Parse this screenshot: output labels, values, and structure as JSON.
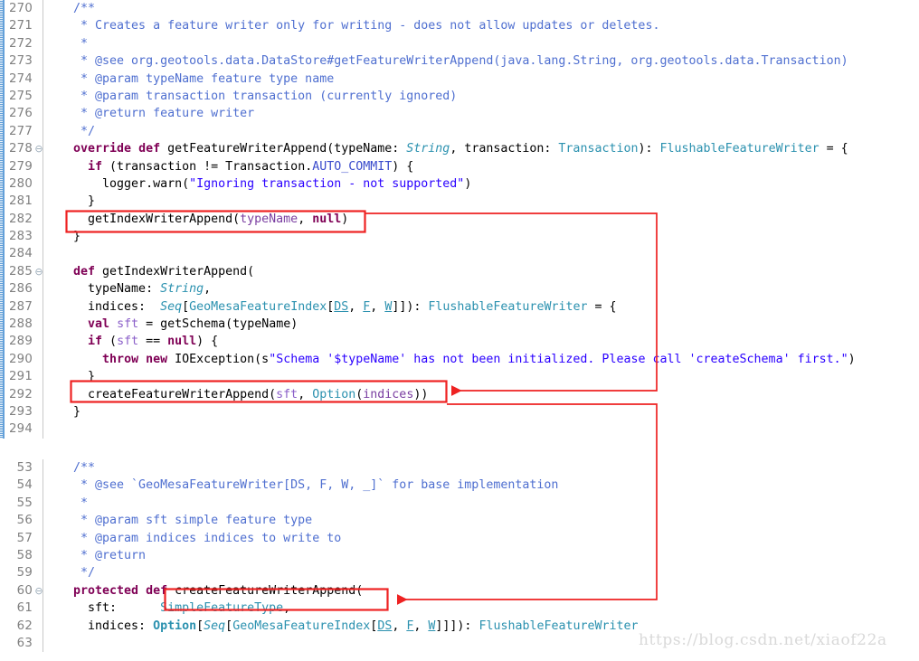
{
  "editor": {
    "font_size_px": 13.3,
    "line_height_px": 19.4,
    "gutter_strip_color": "#64a0d8",
    "line_number_color": "#808080",
    "fold_marker_glyph": "⊖",
    "background": "#ffffff"
  },
  "annotation": {
    "color": "#ee2222",
    "boxes": [
      {
        "id": "box-282",
        "label": "getIndexWriterAppend(typeName, null)"
      },
      {
        "id": "box-292",
        "label": "createFeatureWriterAppend(sft, Option(indices))"
      },
      {
        "id": "box-60",
        "label": "createFeatureWriterAppend("
      }
    ],
    "connectors": [
      {
        "id": "connector-282-to-292",
        "from": "box-282",
        "to": "box-292"
      },
      {
        "id": "connector-292-to-60",
        "from": "box-292",
        "to": "box-60"
      }
    ]
  },
  "watermark": {
    "text": "https://blog.csdn.net/xiaof22a"
  },
  "blocks": [
    {
      "id": "block-top",
      "has_change_strip": true,
      "lines": [
        {
          "no": "270",
          "fold": "",
          "segments": [
            {
              "t": "  /**",
              "c": "c-cmt"
            }
          ]
        },
        {
          "no": "271",
          "fold": "",
          "segments": [
            {
              "t": "   * Creates a feature writer only for writing - does not allow updates or deletes.",
              "c": "c-cmt"
            }
          ]
        },
        {
          "no": "272",
          "fold": "",
          "segments": [
            {
              "t": "   *",
              "c": "c-cmt"
            }
          ]
        },
        {
          "no": "273",
          "fold": "",
          "segments": [
            {
              "t": "   * @see org.geotools.data.DataStore#getFeatureWriterAppend(java.lang.String, org.geotools.data.Transaction)",
              "c": "c-cmt"
            }
          ]
        },
        {
          "no": "274",
          "fold": "",
          "segments": [
            {
              "t": "   * @param typeName feature type name",
              "c": "c-cmt"
            }
          ]
        },
        {
          "no": "275",
          "fold": "",
          "segments": [
            {
              "t": "   * @param transaction transaction (currently ignored)",
              "c": "c-cmt"
            }
          ]
        },
        {
          "no": "276",
          "fold": "",
          "segments": [
            {
              "t": "   * @return feature writer",
              "c": "c-cmt"
            }
          ]
        },
        {
          "no": "277",
          "fold": "",
          "segments": [
            {
              "t": "   */",
              "c": "c-cmt"
            }
          ]
        },
        {
          "no": "278",
          "fold": "⊖",
          "segments": [
            {
              "t": "  ",
              "c": "c-pln"
            },
            {
              "t": "override def",
              "c": "c-kw"
            },
            {
              "t": " getFeatureWriterAppend(typeName: ",
              "c": "c-pln"
            },
            {
              "t": "String",
              "c": "c-typi"
            },
            {
              "t": ", transaction: ",
              "c": "c-pln"
            },
            {
              "t": "Transaction",
              "c": "c-typ"
            },
            {
              "t": "): ",
              "c": "c-pln"
            },
            {
              "t": "FlushableFeatureWriter",
              "c": "c-typ"
            },
            {
              "t": " = {",
              "c": "c-pln"
            }
          ]
        },
        {
          "no": "279",
          "fold": "",
          "segments": [
            {
              "t": "    ",
              "c": "c-pln"
            },
            {
              "t": "if",
              "c": "c-kw"
            },
            {
              "t": " (transaction != Transaction.",
              "c": "c-pln"
            },
            {
              "t": "AUTO_COMMIT",
              "c": "c-stc"
            },
            {
              "t": ") {",
              "c": "c-pln"
            }
          ]
        },
        {
          "no": "280",
          "fold": "",
          "segments": [
            {
              "t": "      logger.warn(",
              "c": "c-pln"
            },
            {
              "t": "\"Ignoring transaction - not supported\"",
              "c": "c-str"
            },
            {
              "t": ")",
              "c": "c-pln"
            }
          ]
        },
        {
          "no": "281",
          "fold": "",
          "segments": [
            {
              "t": "    }",
              "c": "c-pln"
            }
          ]
        },
        {
          "no": "282",
          "fold": "",
          "segments": [
            {
              "t": "    getIndexWriterAppend(",
              "c": "c-pln"
            },
            {
              "t": "typeName",
              "c": "c-fld"
            },
            {
              "t": ", ",
              "c": "c-pln"
            },
            {
              "t": "null",
              "c": "c-kw"
            },
            {
              "t": ")",
              "c": "c-pln"
            }
          ]
        },
        {
          "no": "283",
          "fold": "",
          "segments": [
            {
              "t": "  }",
              "c": "c-pln"
            }
          ]
        },
        {
          "no": "284",
          "fold": "",
          "segments": [
            {
              "t": "",
              "c": "c-pln"
            }
          ]
        },
        {
          "no": "285",
          "fold": "⊖",
          "segments": [
            {
              "t": "  ",
              "c": "c-pln"
            },
            {
              "t": "def",
              "c": "c-kw"
            },
            {
              "t": " getIndexWriterAppend(",
              "c": "c-pln"
            }
          ]
        },
        {
          "no": "286",
          "fold": "",
          "segments": [
            {
              "t": "    typeName: ",
              "c": "c-pln"
            },
            {
              "t": "String",
              "c": "c-typi"
            },
            {
              "t": ",",
              "c": "c-pln"
            }
          ]
        },
        {
          "no": "287",
          "fold": "",
          "segments": [
            {
              "t": "    indices:  ",
              "c": "c-pln"
            },
            {
              "t": "Seq",
              "c": "c-typi"
            },
            {
              "t": "[",
              "c": "c-pln"
            },
            {
              "t": "GeoMesaFeatureIndex",
              "c": "c-typ"
            },
            {
              "t": "[",
              "c": "c-pln"
            },
            {
              "t": "DS",
              "c": "c-typu"
            },
            {
              "t": ", ",
              "c": "c-pln"
            },
            {
              "t": "F",
              "c": "c-typu"
            },
            {
              "t": ", ",
              "c": "c-pln"
            },
            {
              "t": "W",
              "c": "c-typu"
            },
            {
              "t": "]]): ",
              "c": "c-pln"
            },
            {
              "t": "FlushableFeatureWriter",
              "c": "c-typ"
            },
            {
              "t": " = {",
              "c": "c-pln"
            }
          ]
        },
        {
          "no": "288",
          "fold": "",
          "segments": [
            {
              "t": "    ",
              "c": "c-pln"
            },
            {
              "t": "val",
              "c": "c-kw"
            },
            {
              "t": " ",
              "c": "c-pln"
            },
            {
              "t": "sft",
              "c": "c-var"
            },
            {
              "t": " = getSchema(typeName)",
              "c": "c-pln"
            }
          ]
        },
        {
          "no": "289",
          "fold": "",
          "segments": [
            {
              "t": "    ",
              "c": "c-pln"
            },
            {
              "t": "if",
              "c": "c-kw"
            },
            {
              "t": " (",
              "c": "c-pln"
            },
            {
              "t": "sft",
              "c": "c-var"
            },
            {
              "t": " == ",
              "c": "c-pln"
            },
            {
              "t": "null",
              "c": "c-kw"
            },
            {
              "t": ") {",
              "c": "c-pln"
            }
          ]
        },
        {
          "no": "290",
          "fold": "",
          "segments": [
            {
              "t": "      ",
              "c": "c-pln"
            },
            {
              "t": "throw new",
              "c": "c-kw"
            },
            {
              "t": " IOException(s",
              "c": "c-pln"
            },
            {
              "t": "\"Schema '$typeName' has not been initialized. Please call 'createSchema' first.\"",
              "c": "c-str"
            },
            {
              "t": ")",
              "c": "c-pln"
            }
          ]
        },
        {
          "no": "291",
          "fold": "",
          "segments": [
            {
              "t": "    }",
              "c": "c-pln"
            }
          ]
        },
        {
          "no": "292",
          "fold": "",
          "segments": [
            {
              "t": "    createFeatureWriterAppend(",
              "c": "c-pln"
            },
            {
              "t": "sft",
              "c": "c-var"
            },
            {
              "t": ", ",
              "c": "c-pln"
            },
            {
              "t": "Option",
              "c": "c-typ"
            },
            {
              "t": "(",
              "c": "c-pln"
            },
            {
              "t": "indices",
              "c": "c-fld"
            },
            {
              "t": "))",
              "c": "c-pln"
            }
          ]
        },
        {
          "no": "293",
          "fold": "",
          "segments": [
            {
              "t": "  }",
              "c": "c-pln"
            }
          ]
        },
        {
          "no": "294",
          "fold": "",
          "segments": [
            {
              "t": "",
              "c": "c-pln"
            }
          ]
        }
      ]
    },
    {
      "id": "block-bottom",
      "has_change_strip": false,
      "lines": [
        {
          "no": "53",
          "fold": "",
          "segments": [
            {
              "t": "  /**",
              "c": "c-cmt"
            }
          ]
        },
        {
          "no": "54",
          "fold": "",
          "segments": [
            {
              "t": "   * @see `GeoMesaFeatureWriter[DS, F, W, _]` for base implementation",
              "c": "c-cmt"
            }
          ]
        },
        {
          "no": "55",
          "fold": "",
          "segments": [
            {
              "t": "   *",
              "c": "c-cmt"
            }
          ]
        },
        {
          "no": "56",
          "fold": "",
          "segments": [
            {
              "t": "   * @param sft simple feature type",
              "c": "c-cmt"
            }
          ]
        },
        {
          "no": "57",
          "fold": "",
          "segments": [
            {
              "t": "   * @param indices indices to write to",
              "c": "c-cmt"
            }
          ]
        },
        {
          "no": "58",
          "fold": "",
          "segments": [
            {
              "t": "   * @return",
              "c": "c-cmt"
            }
          ]
        },
        {
          "no": "59",
          "fold": "",
          "segments": [
            {
              "t": "   */",
              "c": "c-cmt"
            }
          ]
        },
        {
          "no": "60",
          "fold": "⊖",
          "segments": [
            {
              "t": "  ",
              "c": "c-pln"
            },
            {
              "t": "protected def",
              "c": "c-kw"
            },
            {
              "t": " createFeatureWriterAppend(",
              "c": "c-pln"
            }
          ]
        },
        {
          "no": "61",
          "fold": "",
          "segments": [
            {
              "t": "    sft:      ",
              "c": "c-pln"
            },
            {
              "t": "SimpleFeatureType",
              "c": "c-typ"
            },
            {
              "t": ",",
              "c": "c-pln"
            }
          ]
        },
        {
          "no": "62",
          "fold": "",
          "segments": [
            {
              "t": "    indices: ",
              "c": "c-pln"
            },
            {
              "t": "Option",
              "c": "c-typb"
            },
            {
              "t": "[",
              "c": "c-pln"
            },
            {
              "t": "Seq",
              "c": "c-typi"
            },
            {
              "t": "[",
              "c": "c-pln"
            },
            {
              "t": "GeoMesaFeatureIndex",
              "c": "c-typ"
            },
            {
              "t": "[",
              "c": "c-pln"
            },
            {
              "t": "DS",
              "c": "c-typu"
            },
            {
              "t": ", ",
              "c": "c-pln"
            },
            {
              "t": "F",
              "c": "c-typu"
            },
            {
              "t": ", ",
              "c": "c-pln"
            },
            {
              "t": "W",
              "c": "c-typu"
            },
            {
              "t": "]]]): ",
              "c": "c-pln"
            },
            {
              "t": "FlushableFeatureWriter",
              "c": "c-typ"
            }
          ]
        },
        {
          "no": "63",
          "fold": "",
          "segments": [
            {
              "t": "",
              "c": "c-pln"
            }
          ]
        }
      ]
    }
  ]
}
